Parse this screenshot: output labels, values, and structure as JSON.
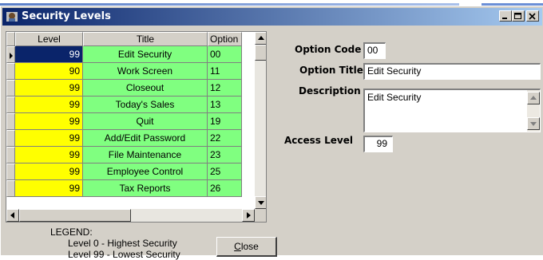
{
  "window": {
    "title": "Security Levels"
  },
  "grid": {
    "columns": [
      "Level",
      "Title",
      "Option"
    ],
    "rows": [
      {
        "level": "99",
        "title": "Edit Security",
        "option": "00",
        "selected": true
      },
      {
        "level": "90",
        "title": "Work Screen",
        "option": "11"
      },
      {
        "level": "99",
        "title": "Closeout",
        "option": "12"
      },
      {
        "level": "99",
        "title": "Today's Sales",
        "option": "13"
      },
      {
        "level": "99",
        "title": "Quit",
        "option": "19"
      },
      {
        "level": "99",
        "title": "Add/Edit Password",
        "option": "22"
      },
      {
        "level": "99",
        "title": "File Maintenance",
        "option": "23"
      },
      {
        "level": "99",
        "title": "Employee Control",
        "option": "25"
      },
      {
        "level": "99",
        "title": "Tax Reports",
        "option": "26"
      }
    ]
  },
  "legend": {
    "heading": "LEGEND:",
    "line1": "Level 0 - Highest Security",
    "line2": "Level 99 - Lowest Security"
  },
  "buttons": {
    "close_prefix": "C",
    "close_rest": "lose"
  },
  "form": {
    "option_code_label": "Option Code",
    "option_code": "00",
    "option_title_label": "Option Title",
    "option_title": "Edit Security",
    "description_label": "Description",
    "description": "Edit Security",
    "access_level_label": "Access  Level",
    "access_level": "99"
  },
  "colors": {
    "level_cell": "#ffff00",
    "title_cell": "#80ff80",
    "selected": "#0a246a",
    "titlebar": "#0a246a"
  }
}
